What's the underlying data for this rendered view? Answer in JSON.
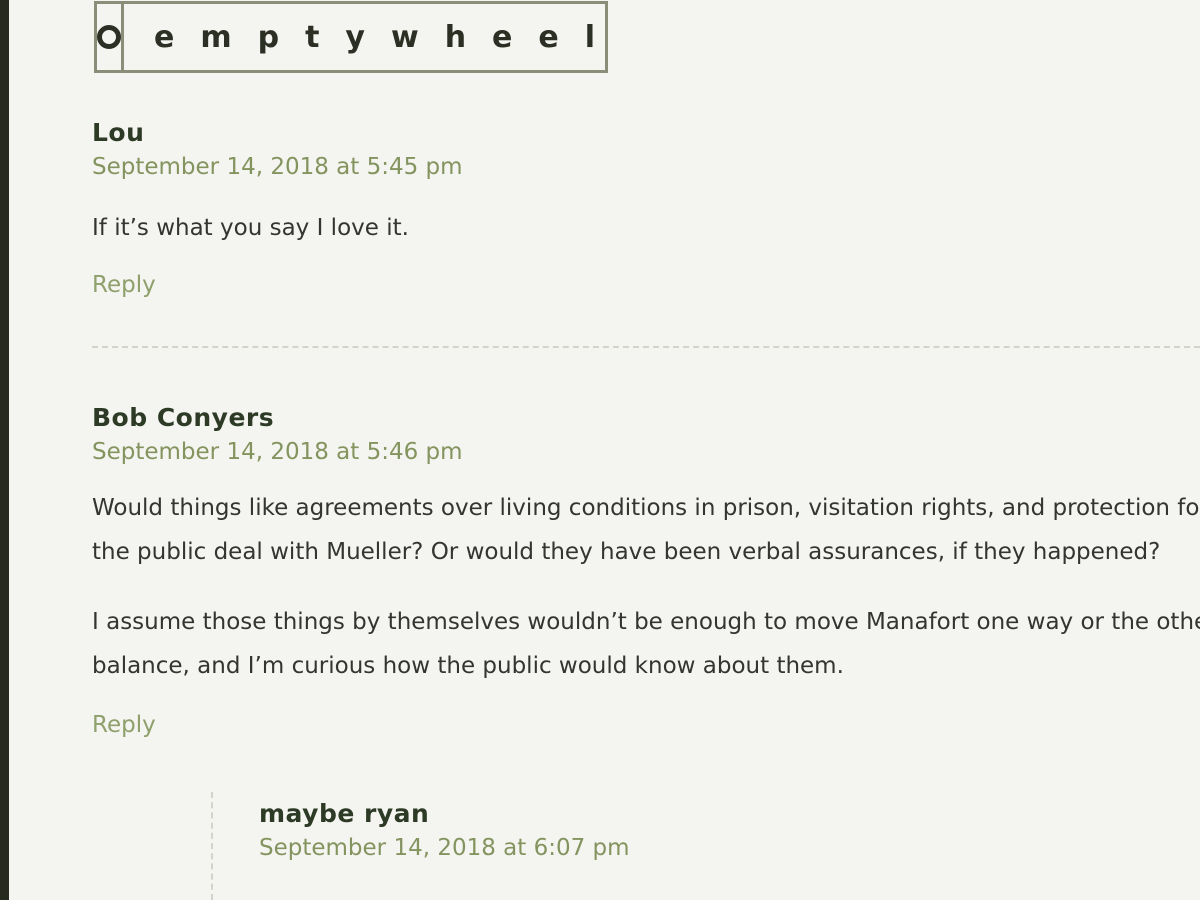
{
  "logo": {
    "text": "emptywheel",
    "icon": "circle-logo-icon"
  },
  "comments": [
    {
      "author": "Lou",
      "date": "September 14, 2018 at 5:45 pm",
      "paragraphs": [
        "If it’s what you say I love it."
      ],
      "reply": "Reply"
    },
    {
      "author": "Bob Conyers",
      "date": "September 14, 2018 at 5:46 pm",
      "paragraphs": [
        "Would things like agreements over living conditions in prison, visitation rights, and protection for",
        "the public deal with Mueller? Or would they have been verbal assurances, if they happened?",
        "I assume those things by themselves wouldn’t be enough to move Manafort one way or the other,",
        "balance, and I’m curious how the public would know about them."
      ],
      "reply": "Reply"
    },
    {
      "author": "maybe ryan",
      "date": "September 14, 2018 at 6:07 pm"
    }
  ]
}
